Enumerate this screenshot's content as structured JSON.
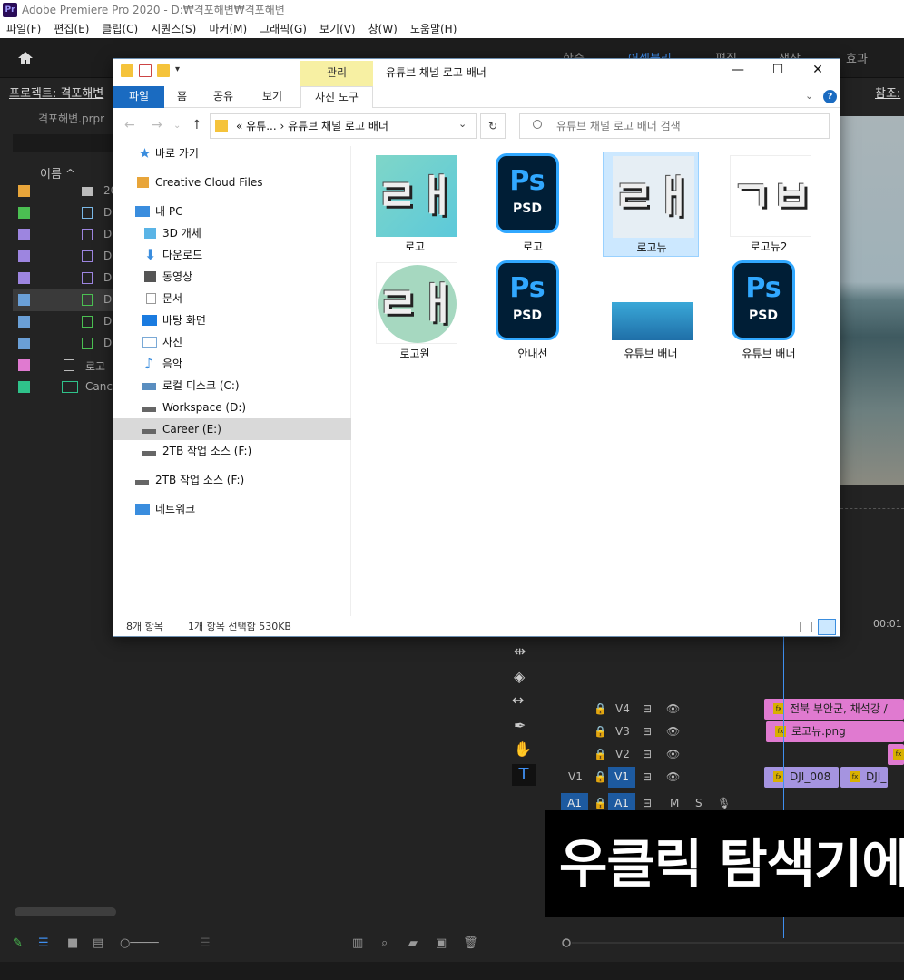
{
  "premiere": {
    "title": "Adobe Premiere Pro 2020 - D:₩격포해변₩격포해변",
    "logo": "Pr",
    "menu": [
      "파일(F)",
      "편집(E)",
      "클립(C)",
      "시퀀스(S)",
      "마커(M)",
      "그래픽(G)",
      "보기(V)",
      "창(W)",
      "도움말(H)"
    ],
    "workspaces": [
      "학습",
      "어셈블리",
      "편집",
      "색상",
      "효과"
    ],
    "project_title": "프로젝트: 격포해변",
    "project_file": "격포해변.prpr",
    "col_name": "이름 ^",
    "rows": [
      {
        "color": "#e8a53a",
        "text": "2020"
      },
      {
        "color": "#4bbf52",
        "text": "D"
      },
      {
        "color": "#9d85e0",
        "text": "D"
      },
      {
        "color": "#9d85e0",
        "text": "D"
      },
      {
        "color": "#9d85e0",
        "text": "D"
      },
      {
        "color": "#6a9fd6",
        "text": "D"
      },
      {
        "color": "#6a9fd6",
        "text": "D"
      },
      {
        "color": "#6a9fd6",
        "text": "D"
      },
      {
        "color": "#e07ad0",
        "text": "로고"
      },
      {
        "color": "#2fc28a",
        "text": "Canc"
      }
    ],
    "ref_title": "참조:",
    "timecode": "00:01",
    "tracks": [
      {
        "label": "V4",
        "clip": "전북 부안군, 채석강 /",
        "clipColor": "#e07ad0"
      },
      {
        "label": "V3",
        "clip": "로고뉴.png",
        "clipColor": "#e07ad0"
      },
      {
        "label": "V2",
        "clip": "",
        "clipColor": "#e07ad0"
      },
      {
        "label": "V1",
        "clip": "DJI_008",
        "clip2": "DJI_",
        "clipColor": "#a594e0"
      },
      {
        "label": "A1",
        "clip": "",
        "clipColor": "#1f8a5a"
      }
    ],
    "v1_left": "V1",
    "a1_left": "A1",
    "caption": "우클릭 탐색기에"
  },
  "explorer": {
    "context_tab": "관리",
    "title": "유튜브 채널 로고 배너",
    "ribbon": [
      "파일",
      "홈",
      "공유",
      "보기",
      "사진 도구"
    ],
    "address": "«  유튜...  ›  유튜브 채널 로고 배너",
    "search_placeholder": "유튜브 채널 로고 배너 검색",
    "nav": [
      {
        "label": "바로 가기",
        "icon": "#3a8dde"
      },
      {
        "label": "Creative Cloud Files",
        "icon": "#e8a53a"
      },
      {
        "label": "내 PC",
        "icon": "#3a8dde"
      },
      {
        "label": "3D 개체",
        "icon": "#5ab4e6"
      },
      {
        "label": "다운로드",
        "icon": "#3a8dde"
      },
      {
        "label": "동영상",
        "icon": "#555"
      },
      {
        "label": "문서",
        "icon": "#aaa"
      },
      {
        "label": "바탕 화면",
        "icon": "#1a7be0"
      },
      {
        "label": "사진",
        "icon": "#7aa9d6"
      },
      {
        "label": "음악",
        "icon": "#3a8dde"
      },
      {
        "label": "로컬 디스크 (C:)",
        "icon": "#5a8ec0"
      },
      {
        "label": "Workspace (D:)",
        "icon": "#666"
      },
      {
        "label": "Career (E:)",
        "icon": "#666"
      },
      {
        "label": "2TB 작업 소스 (F:)",
        "icon": "#666"
      },
      {
        "label": "2TB 작업 소스 (F:)",
        "icon": "#666"
      },
      {
        "label": "네트워크",
        "icon": "#3a8dde"
      }
    ],
    "items": [
      {
        "label": "로고",
        "type": "logo",
        "glyph": "ㄹㅐ",
        "bg": "#7fd6c8"
      },
      {
        "label": "로고",
        "type": "psd"
      },
      {
        "label": "로고뉴",
        "type": "logo",
        "glyph": "ㄹㅐ",
        "bg": "#e6eef4",
        "selected": true
      },
      {
        "label": "로고뉴2",
        "type": "logo",
        "glyph": "ㄱㅂ",
        "bg": "#ffffff"
      },
      {
        "label": "로고원",
        "type": "logo-round",
        "glyph": "ㄹㅐ",
        "bg": "#a6d8c0"
      },
      {
        "label": "안내선",
        "type": "psd"
      },
      {
        "label": "유튜브 배너",
        "type": "banner"
      },
      {
        "label": "유튜브 배너",
        "type": "psd"
      }
    ],
    "psd_text": "Ps",
    "psd_sub": "PSD",
    "status_count": "8개 항목",
    "status_selected": "1개 항목 선택함 530KB"
  }
}
